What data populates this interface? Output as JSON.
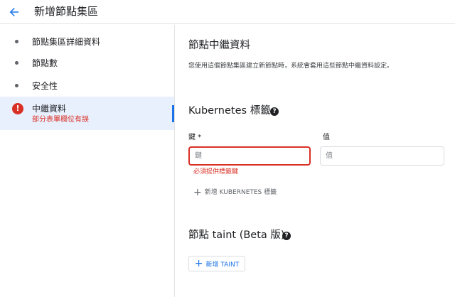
{
  "header": {
    "title": "新增節點集區"
  },
  "sidebar": {
    "items": [
      {
        "label": "節點集區詳細資料"
      },
      {
        "label": "節點數"
      },
      {
        "label": "安全性"
      },
      {
        "label": "中繼資料",
        "error_icon": "!",
        "error_text": "部分表單欄位有誤"
      }
    ]
  },
  "main": {
    "metadata_title": "節點中繼資料",
    "metadata_desc": "您使用這個節點集區建立新節點時，系統會套用這些節點中繼資料設定。",
    "labels_title": "Kubernetes 標籤",
    "key_label": "鍵 *",
    "value_label": "值",
    "key_placeholder": "鍵",
    "value_placeholder": "值",
    "key_error": "必須提供標籤鍵",
    "add_label_button": "新增 KUBERNETES 標籤",
    "taint_title": "節點 taint (Beta 版)",
    "add_taint_button": "新增 TAINT",
    "help_glyph": "?",
    "plus_glyph": "+"
  },
  "colors": {
    "accent": "#1a73e8",
    "error": "#d93025",
    "active_bg": "#e8f0fe"
  }
}
